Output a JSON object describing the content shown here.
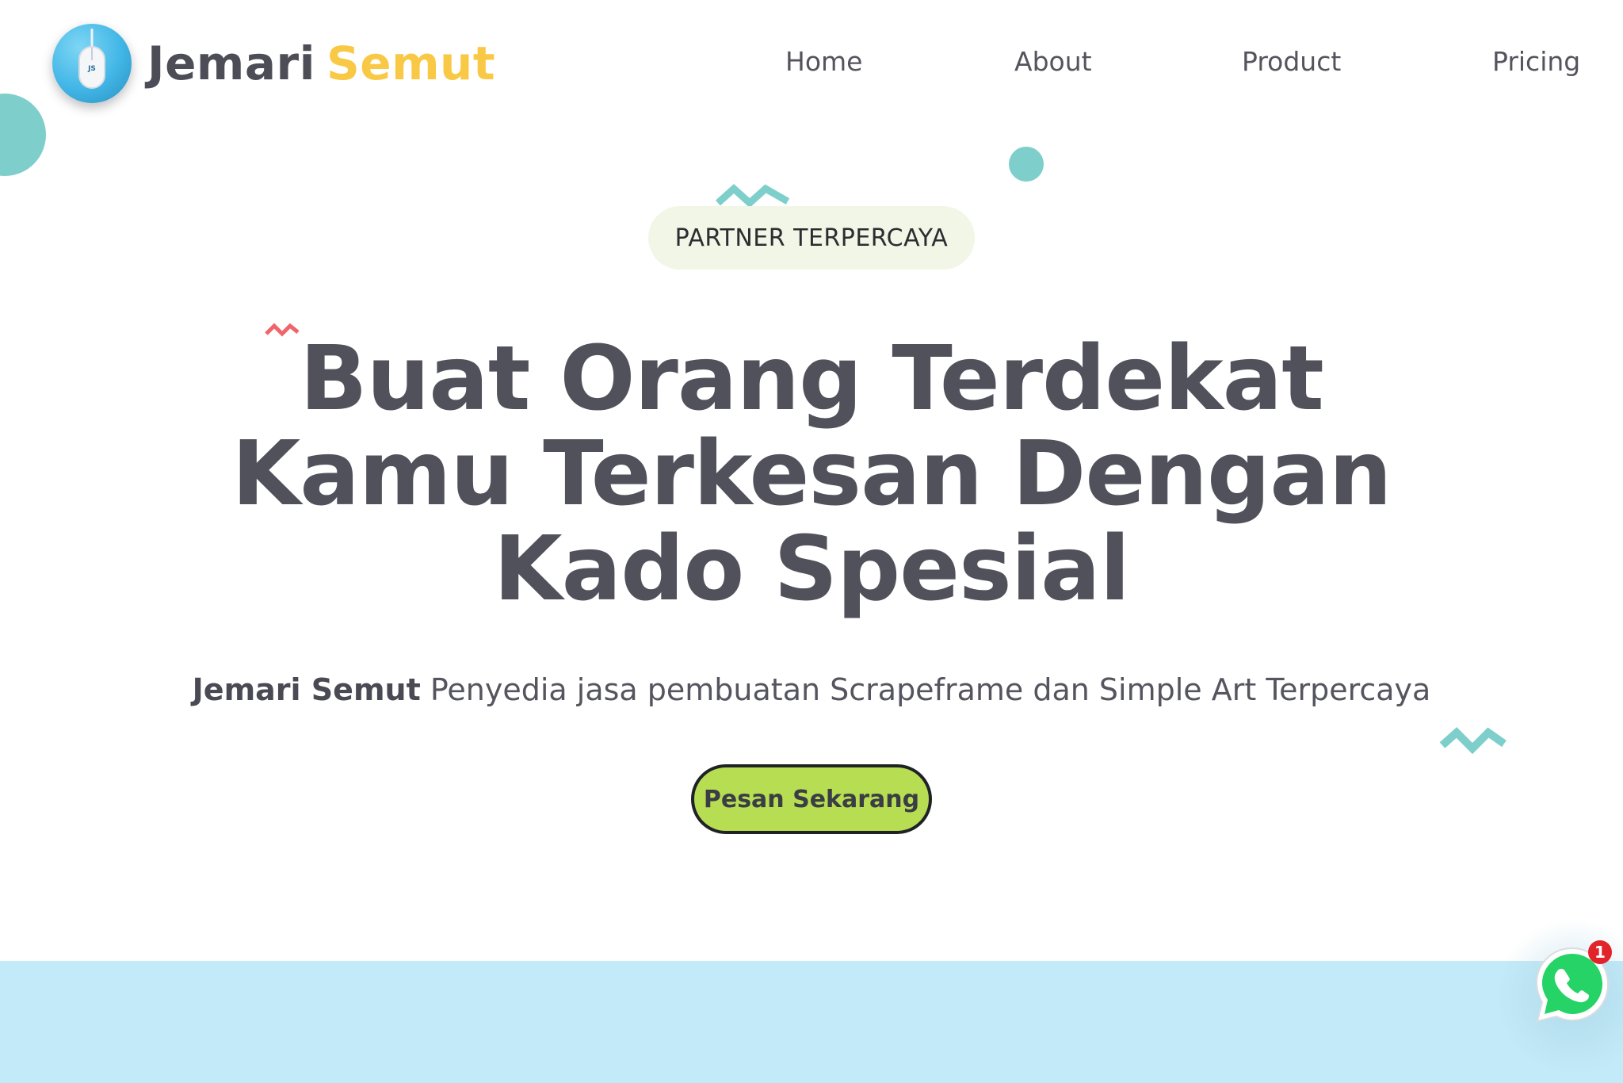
{
  "brand": {
    "name_part1": "Jemari",
    "name_part2": "Semut",
    "logo_mark": "JS",
    "accent_color": "#f9c946",
    "text_color": "#4d4d57"
  },
  "nav": {
    "items": [
      {
        "label": "Home"
      },
      {
        "label": "About"
      },
      {
        "label": "Product"
      },
      {
        "label": "Pricing"
      }
    ]
  },
  "hero": {
    "badge": "PARTNER TERPERCAYA",
    "headline_lines": [
      "Buat Orang Terdekat",
      "Kamu Terkesan Dengan",
      "Kado Spesial"
    ],
    "subtitle_brand": "Jemari Semut",
    "subtitle_rest": " Penyedia jasa pembuatan Scrapeframe dan Simple Art Terpercaya",
    "cta_label": "Pesan Sekarang",
    "cta_color": "#b7dd52",
    "badge_bg": "#f1f6e6"
  },
  "decorations": {
    "teal": "#7ecfcb",
    "red": "#f0656b",
    "band_color": "#c3eaf8"
  },
  "whatsapp": {
    "icon": "whatsapp-icon",
    "notification_count": "1",
    "color": "#25d366"
  }
}
